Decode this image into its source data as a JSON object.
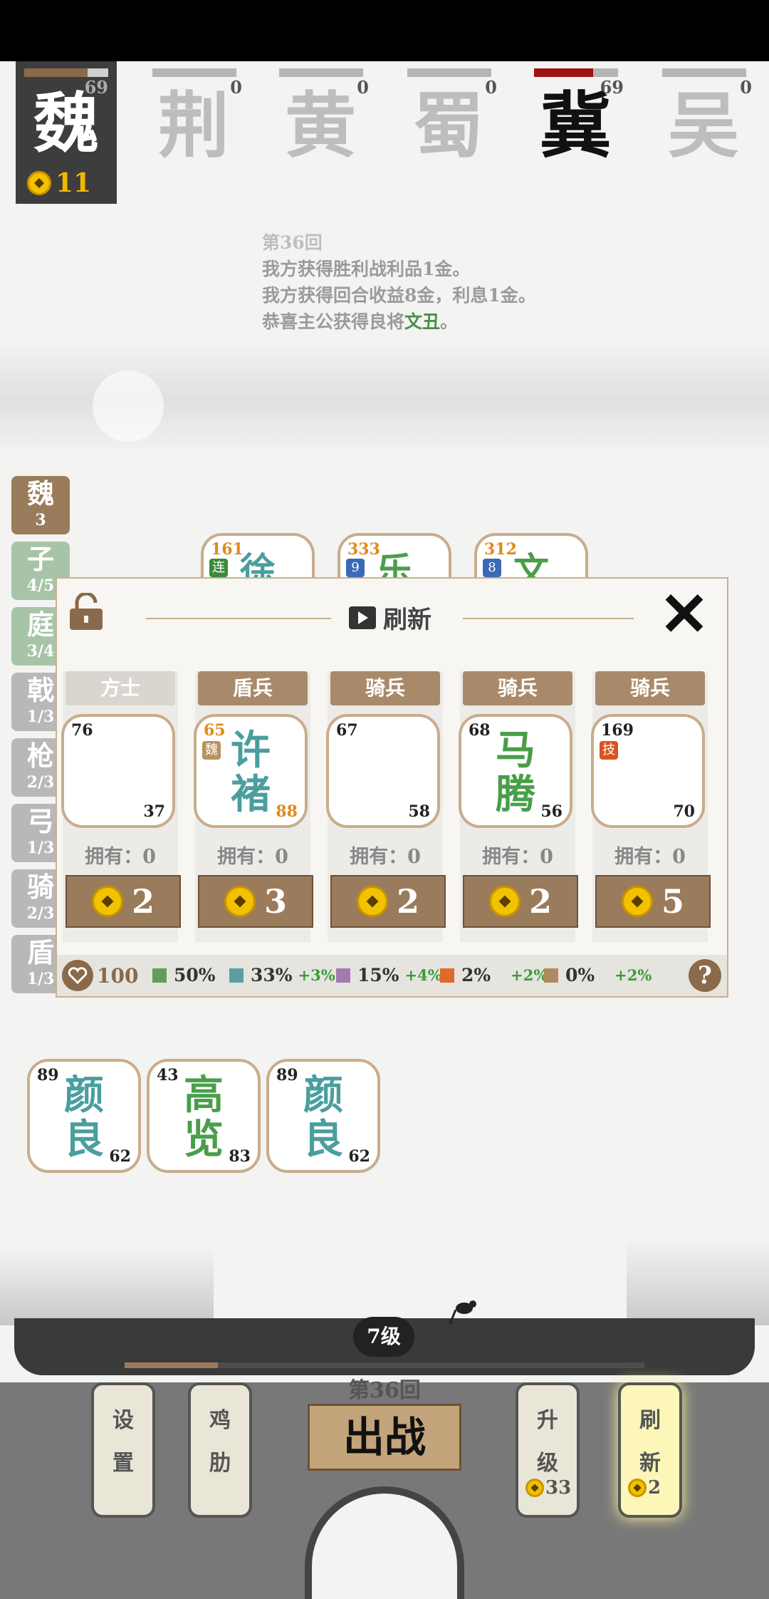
{
  "factions": {
    "player": {
      "name": "魏",
      "count": "69",
      "gold": "11",
      "bar_fraction": 0.75
    },
    "others": [
      {
        "name": "荆",
        "count": "0",
        "bar_fraction": 0
      },
      {
        "name": "黄",
        "count": "0",
        "bar_fraction": 0
      },
      {
        "name": "蜀",
        "count": "0",
        "bar_fraction": 0
      },
      {
        "name": "冀",
        "count": "69",
        "bar_fraction": 0.7
      },
      {
        "name": "吴",
        "count": "0",
        "bar_fraction": 0
      }
    ]
  },
  "log": {
    "round": "第36回",
    "line1": "我方获得胜利战利品1金。",
    "line2": "我方获得回合收益8金，利息1金。",
    "line3_prefix": "恭喜主公获得良将",
    "line3_name": "文丑",
    "line3_suffix": "。"
  },
  "side_tabs": [
    {
      "label": "魏",
      "count": "3"
    },
    {
      "label": "子",
      "count": "4/5"
    },
    {
      "label": "庭",
      "count": "3/4"
    },
    {
      "label": "戟",
      "count": "1/3"
    },
    {
      "label": "枪",
      "count": "2/3"
    },
    {
      "label": "弓",
      "count": "1/3"
    },
    {
      "label": "骑",
      "count": "2/3"
    },
    {
      "label": "盾",
      "count": "1/3"
    }
  ],
  "board_cards": [
    {
      "top": "161",
      "tag": "连",
      "name": "徐"
    },
    {
      "top": "333",
      "tag": "9",
      "name": "乐"
    },
    {
      "top": "312",
      "tag": "8",
      "name": "文"
    }
  ],
  "shop": {
    "title": "刷新",
    "slots": [
      {
        "type": "方士",
        "atk": "76",
        "def": "37",
        "name1": "",
        "name2": "",
        "tag": "",
        "own": "拥有：0",
        "price": "2"
      },
      {
        "type": "盾兵",
        "atk": "65",
        "def": "88",
        "name1": "许",
        "name2": "褚",
        "tag": "魏",
        "own": "拥有：0",
        "price": "3"
      },
      {
        "type": "骑兵",
        "atk": "67",
        "def": "58",
        "name1": "",
        "name2": "",
        "tag": "",
        "own": "拥有：0",
        "price": "2"
      },
      {
        "type": "骑兵",
        "atk": "68",
        "def": "56",
        "name1": "马",
        "name2": "腾",
        "tag": "",
        "own": "拥有：0",
        "price": "2"
      },
      {
        "type": "骑兵",
        "atk": "169",
        "def": "70",
        "name1": "",
        "name2": "",
        "tag": "技",
        "own": "拥有：0",
        "price": "5"
      }
    ],
    "footer": {
      "hearts": "100",
      "odds": [
        {
          "pct": "50%",
          "delta": "",
          "color": "#5f9e5f"
        },
        {
          "pct": "33%",
          "delta": "+3%",
          "color": "#5f9ea0"
        },
        {
          "pct": "15%",
          "delta": "+4%",
          "color": "#a47ab5"
        },
        {
          "pct": "2%",
          "delta": "+2%",
          "color": "#e06a2a"
        },
        {
          "pct": "0%",
          "delta": "+2%",
          "color": "#b08a5e"
        }
      ],
      "help": "?"
    }
  },
  "bench": [
    {
      "atk": "89",
      "def": "62",
      "name1": "颜",
      "name2": "良"
    },
    {
      "atk": "43",
      "def": "83",
      "name1": "高",
      "name2": "览"
    },
    {
      "atk": "89",
      "def": "62",
      "name1": "颜",
      "name2": "良"
    }
  ],
  "bottom": {
    "level": "7级",
    "round": "第36回",
    "battle": "出战",
    "settings": [
      "设",
      "置"
    ],
    "helper": [
      "鸡",
      "肋"
    ],
    "upgrade": [
      "升",
      "级"
    ],
    "upgrade_cost": "33",
    "refresh": [
      "刷",
      "新"
    ],
    "refresh_cost": "2",
    "xp_fraction": 0.18
  }
}
